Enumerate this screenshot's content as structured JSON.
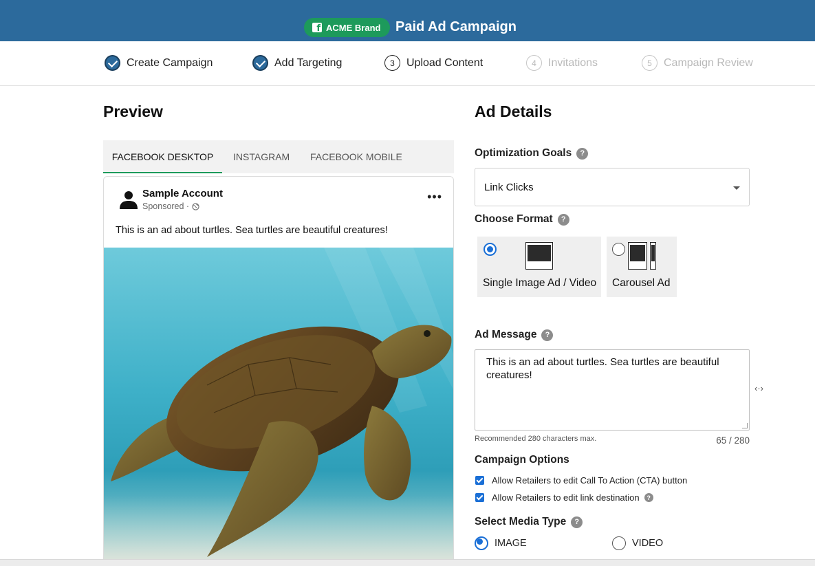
{
  "header": {
    "brand_label": "ACME Brand",
    "title": "Paid Ad Campaign",
    "color": "#2c6a9c",
    "brand_color": "#1d9a5b"
  },
  "stepper": {
    "steps": [
      {
        "label": "Create Campaign",
        "state": "done"
      },
      {
        "label": "Add Targeting",
        "state": "done"
      },
      {
        "number": "3",
        "label": "Upload Content",
        "state": "current"
      },
      {
        "number": "4",
        "label": "Invitations",
        "state": "disabled"
      },
      {
        "number": "5",
        "label": "Campaign Review",
        "state": "disabled"
      }
    ]
  },
  "preview": {
    "heading": "Preview",
    "tabs": [
      "FACEBOOK DESKTOP",
      "INSTAGRAM",
      "FACEBOOK MOBILE"
    ],
    "active_tab": "FACEBOOK DESKTOP",
    "post": {
      "account_name": "Sample Account",
      "sponsored": "Sponsored ·",
      "text": "This is an ad about turtles. Sea turtles are beautiful creatures!",
      "image": "sea-turtle-photo"
    }
  },
  "details": {
    "heading": "Ad Details",
    "optimization": {
      "label": "Optimization Goals",
      "value": "Link Clicks"
    },
    "format": {
      "label": "Choose Format",
      "options": [
        {
          "label": "Single Image Ad / Video",
          "selected": true
        },
        {
          "label": "Carousel Ad",
          "selected": false
        }
      ]
    },
    "ad_message": {
      "label": "Ad Message",
      "value": "This is an ad about turtles. Sea turtles are beautiful creatures!",
      "hint": "Recommended 280 characters max.",
      "counter": "65 / 280"
    },
    "campaign_options": {
      "label": "Campaign Options",
      "options": [
        {
          "label": "Allow Retailers to edit Call To Action (CTA) button",
          "checked": true
        },
        {
          "label": "Allow Retailers to edit link destination",
          "checked": true
        }
      ]
    },
    "media_type": {
      "label": "Select Media Type",
      "options": [
        {
          "label": "IMAGE",
          "selected": true
        },
        {
          "label": "VIDEO",
          "selected": false
        }
      ]
    }
  }
}
